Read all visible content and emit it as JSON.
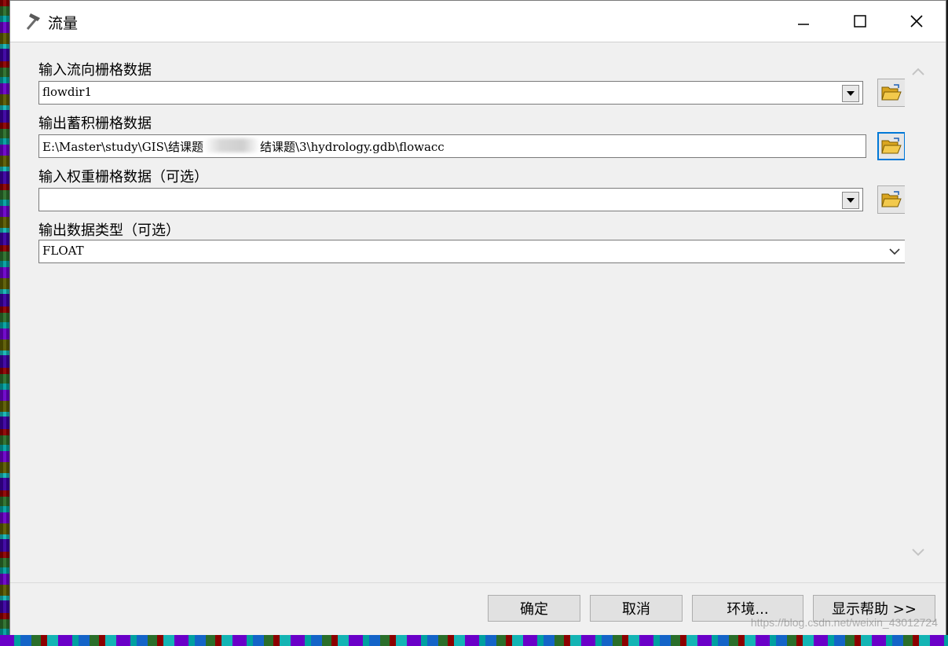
{
  "window": {
    "title": "流量",
    "icon": "hammer-icon",
    "controls": [
      "minimize-icon",
      "maximize-icon",
      "close-icon"
    ]
  },
  "fields": [
    {
      "label": "输入流向栅格数据",
      "value": "flowdir1",
      "type": "combo-with-browse"
    },
    {
      "label": "输出蓄积栅格数据",
      "value_prefix": "E:\\Master\\study\\GIS\\结课题",
      "value_suffix": "结课题\\3\\hydrology.gdb\\flowacc",
      "type": "text-with-browse"
    },
    {
      "label": "输入权重栅格数据（可选）",
      "value": "",
      "type": "combo-with-browse"
    },
    {
      "label": "输出数据类型（可选）",
      "value": "FLOAT",
      "type": "select"
    }
  ],
  "buttons": {
    "ok": "确定",
    "cancel": "取消",
    "environments": "环境...",
    "show_help": "显示帮助 >>"
  },
  "watermark": "https://blog.csdn.net/weixin_43012724",
  "colors": {
    "focus": "#0078d7",
    "folder": "#e8b530"
  }
}
